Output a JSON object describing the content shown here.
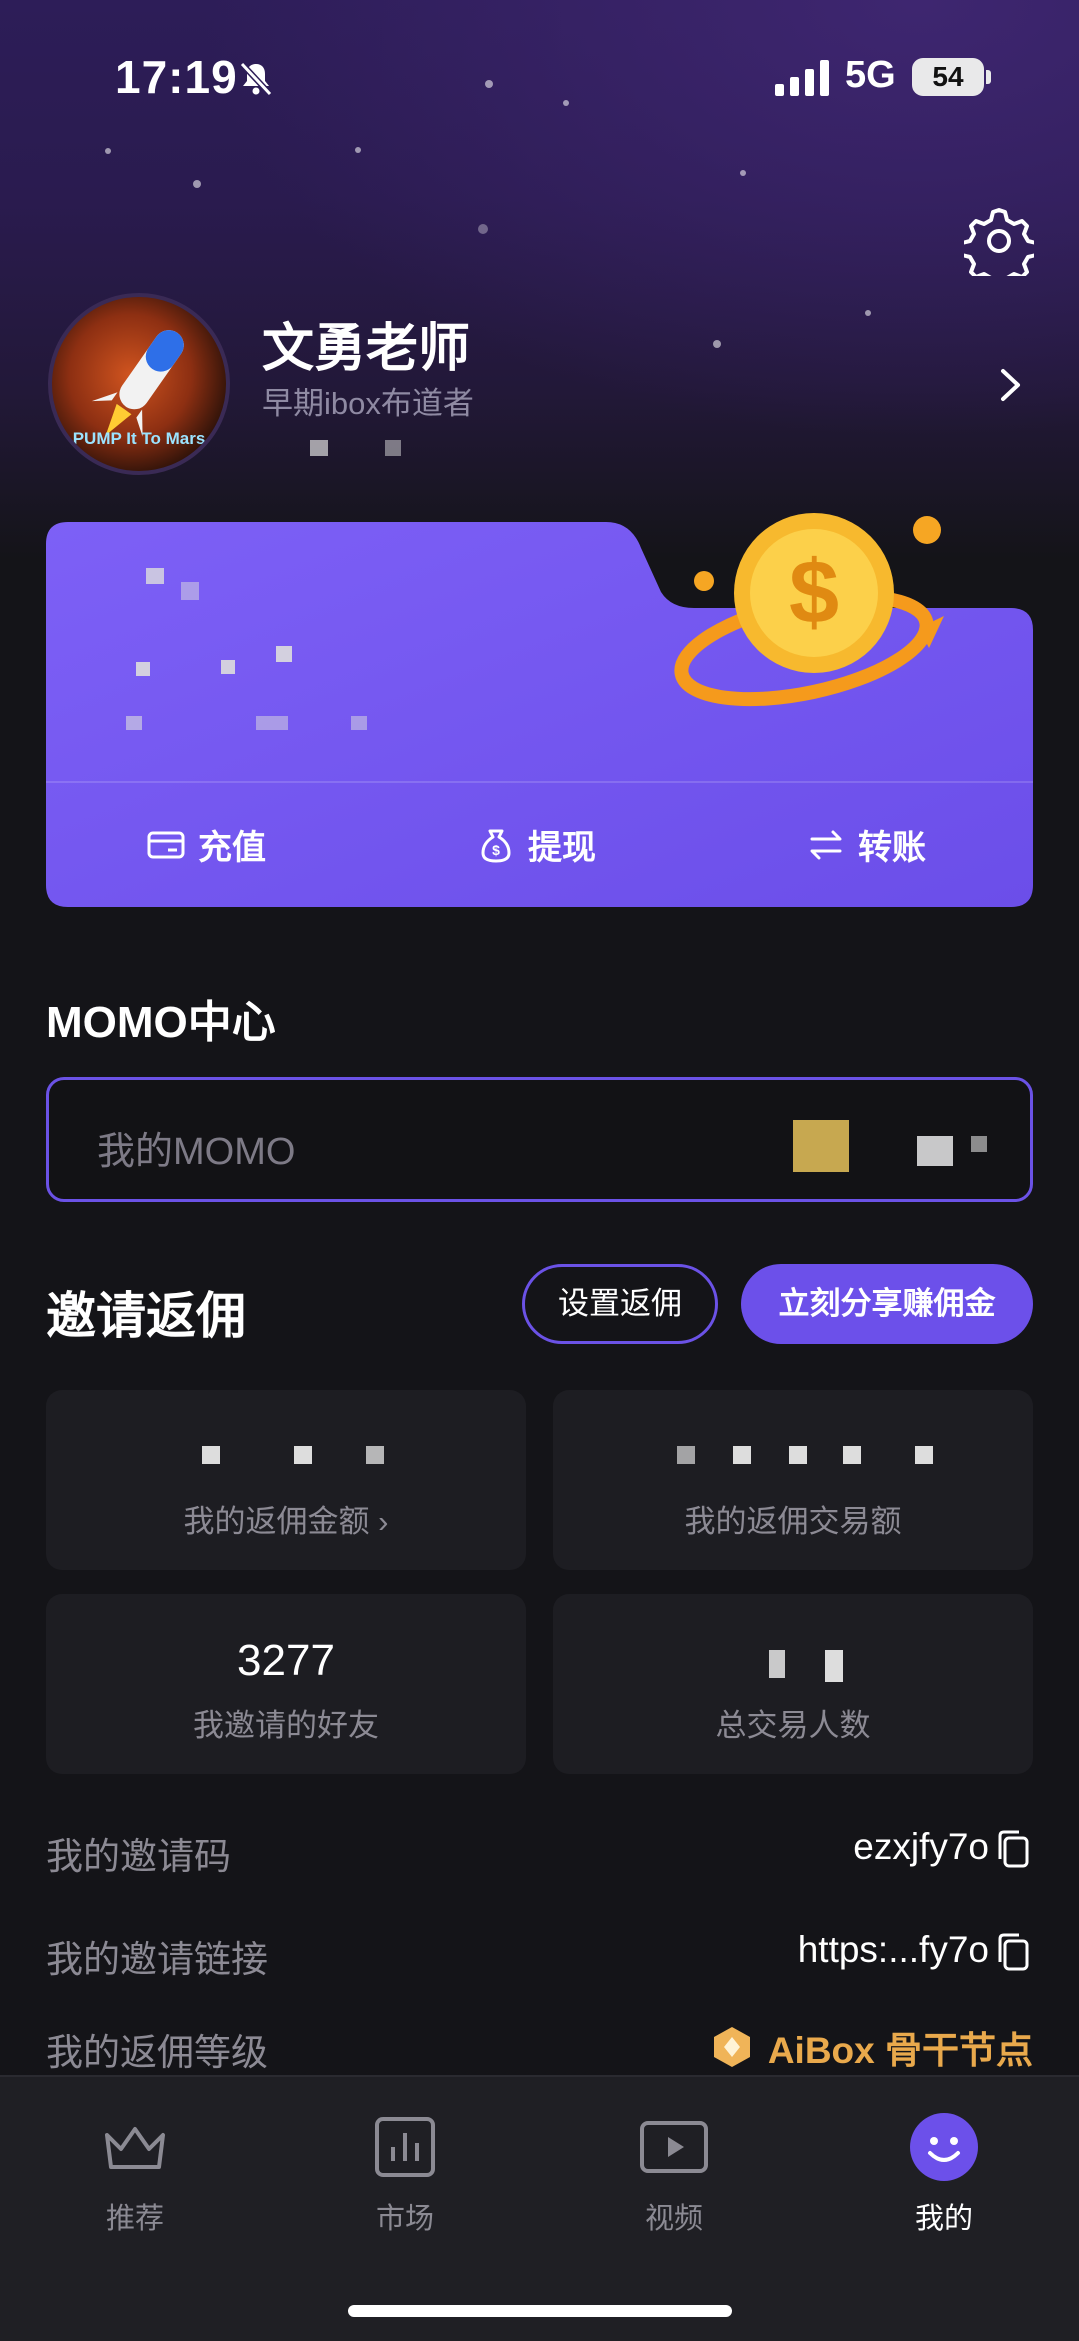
{
  "status": {
    "time": "17:19",
    "network": "5G",
    "battery": "54"
  },
  "profile": {
    "name": "文勇老师",
    "bio": "早期ibox布道者",
    "avatar_caption": "PUMP It To Mars"
  },
  "wallet": {
    "actions": [
      {
        "label": "充值",
        "icon": "card-icon"
      },
      {
        "label": "提现",
        "icon": "money-bag-icon"
      },
      {
        "label": "转账",
        "icon": "transfer-icon"
      }
    ]
  },
  "momo": {
    "title": "MOMO中心",
    "field_label": "我的MOMO"
  },
  "invite": {
    "title": "邀请返佣",
    "set_button": "设置返佣",
    "share_button": "立刻分享赚佣金",
    "stats": [
      {
        "label": "我的返佣金额",
        "value": ""
      },
      {
        "label": "我的返佣交易额",
        "value": ""
      },
      {
        "label": "我邀请的好友",
        "value": "3277"
      },
      {
        "label": "总交易人数",
        "value": ""
      }
    ],
    "code_label": "我的邀请码",
    "code_value": "ezxjfy7o",
    "link_label": "我的邀请链接",
    "link_value": "https:...fy7o",
    "level_label": "我的返佣等级",
    "level_value": "AiBox 骨干节点"
  },
  "colors": {
    "accent": "#6c50ea",
    "card": "#7b5cf4",
    "gold": "#e9a94c",
    "background": "#141418"
  },
  "tabs": [
    {
      "label": "推荐",
      "icon": "crown-icon",
      "active": false
    },
    {
      "label": "市场",
      "icon": "chart-icon",
      "active": false
    },
    {
      "label": "视频",
      "icon": "video-icon",
      "active": false
    },
    {
      "label": "我的",
      "icon": "smiley-icon",
      "active": true
    }
  ]
}
